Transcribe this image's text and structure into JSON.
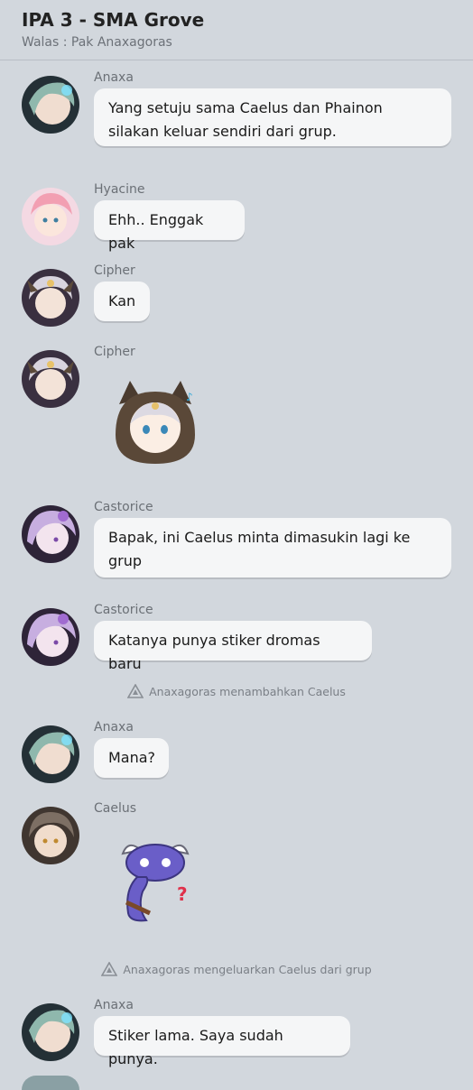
{
  "header": {
    "title": "IPA 3 - SMA Grove",
    "subtitle": "Walas : Pak Anaxagoras"
  },
  "messages": [
    {
      "sender": "Anaxa",
      "text": "Yang setuju sama Caelus dan Phainon\nsilakan keluar sendiri dari grup."
    },
    {
      "sender": "Hyacine",
      "text": "Ehh.. Enggak pak"
    },
    {
      "sender": "Cipher",
      "text": "Kan"
    },
    {
      "sender": "Cipher",
      "sticker": "cat-hood-sticker"
    },
    {
      "sender": "Castorice",
      "text": "Bapak, ini Caelus minta dimasukin lagi ke\ngrup"
    },
    {
      "sender": "Castorice",
      "text": "Katanya punya stiker dromas baru"
    },
    {
      "system": "Anaxagoras menambahkan Caelus"
    },
    {
      "sender": "Anaxa",
      "text": "Mana?"
    },
    {
      "sender": "Caelus",
      "sticker": "dromas-question-sticker"
    },
    {
      "system": "Anaxagoras mengeluarkan Caelus dari grup"
    },
    {
      "sender": "Anaxa",
      "text": "Stiker lama. Saya sudah punya."
    }
  ],
  "colors": {
    "background": "#d2d7dd",
    "bubble": "#f5f6f7",
    "anaxa": "#7fa79f",
    "hyacine": "#f2a8b8",
    "cipher": "#8c7aa8",
    "castorice": "#b79ad0",
    "caelus": "#8a7b6c"
  }
}
